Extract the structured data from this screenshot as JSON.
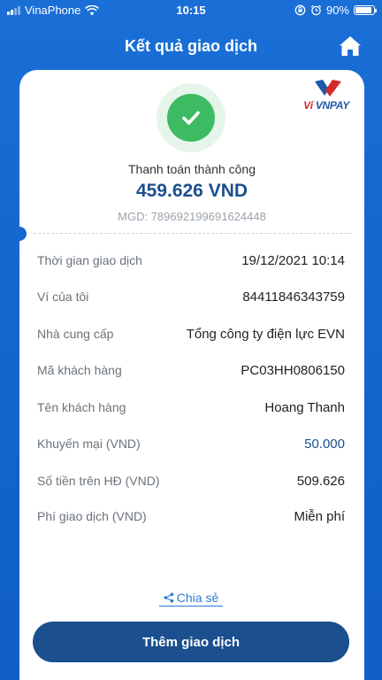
{
  "status_bar": {
    "carrier": "VinaPhone",
    "time": "10:15",
    "battery": "90%",
    "battery_level": 0.9
  },
  "header": {
    "title": "Kết quả giao dịch",
    "home_icon": "home-icon"
  },
  "brand": {
    "logo_text_red": "Ví ",
    "logo_text_blue": "VNPAY"
  },
  "result": {
    "status": "Thanh toán thành công",
    "amount": "459.626 VND",
    "transaction_code": "MGD: 789692199691624448",
    "status_icon": "check-icon",
    "accent": "#3dbb62"
  },
  "details": [
    {
      "label": "Thời gian giao dịch",
      "value": "19/12/2021 10:14"
    },
    {
      "label": "Ví của tôi",
      "value": "84411846343759"
    },
    {
      "label": "Nhà cung cấp",
      "value": "Tổng công ty điện lực EVN"
    },
    {
      "label": "Mã khách hàng",
      "value": "PC03HH0806150"
    },
    {
      "label": "Tên khách hàng",
      "value": "Hoang Thanh"
    },
    {
      "label": "Khuyến mại (VND)",
      "value": "50.000"
    },
    {
      "label": "Số tiền trên HĐ (VND)",
      "value": "509.626"
    },
    {
      "label": "Phí giao dịch (VND)",
      "value": "Miễn phí"
    }
  ],
  "share": {
    "label": "Chia sẻ",
    "icon": "share-icon"
  },
  "actions": {
    "add_transaction": "Thêm giao dịch"
  },
  "colors": {
    "primary": "#1b4f8e",
    "background": "#1467cf",
    "link": "#2b7bd6"
  }
}
